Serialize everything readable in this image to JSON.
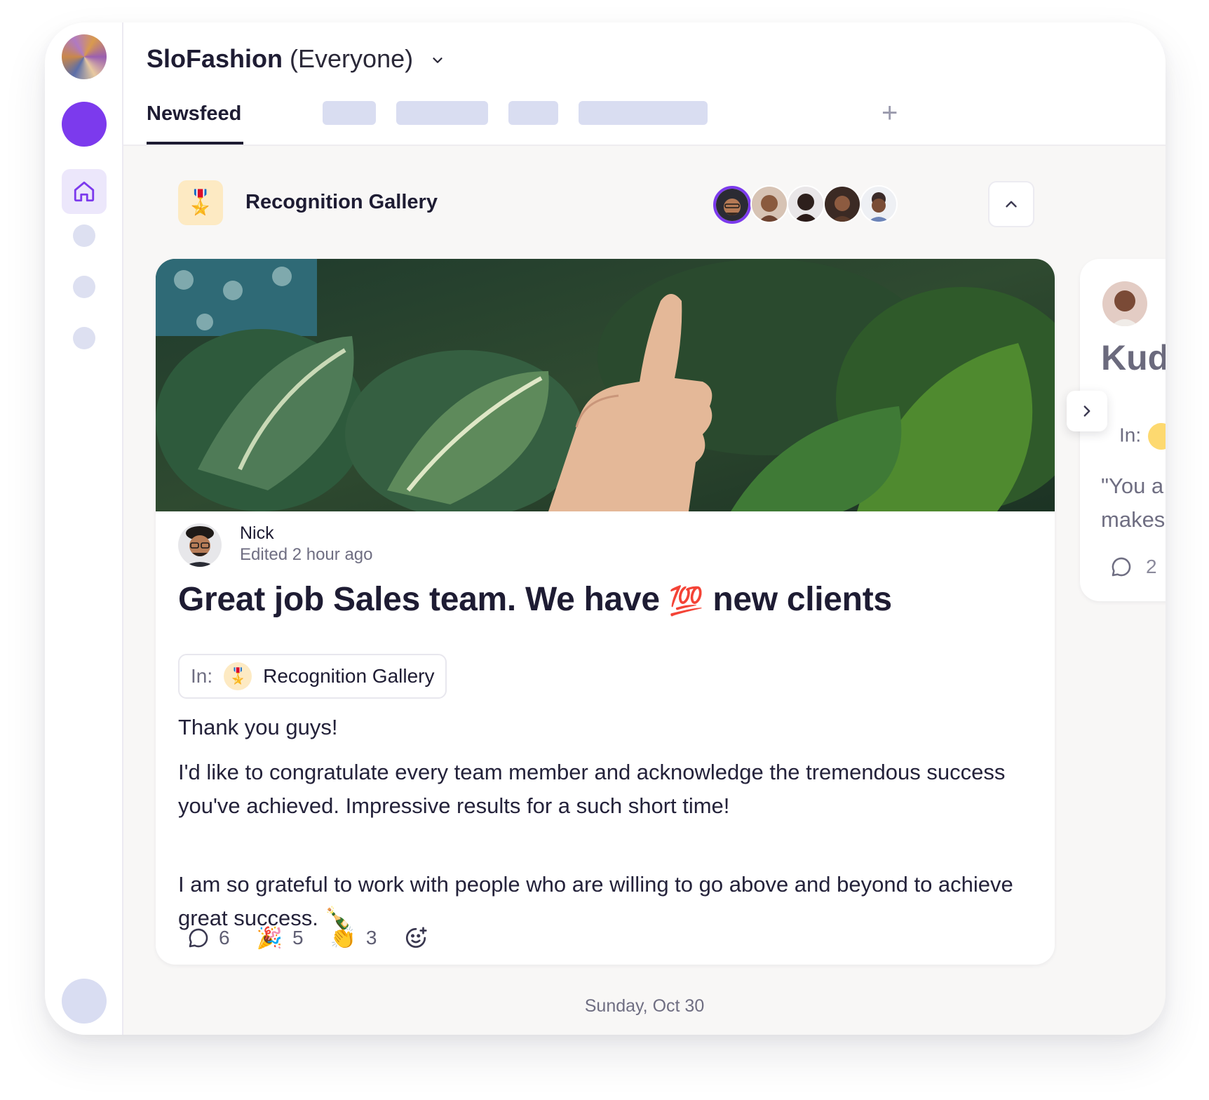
{
  "workspace": {
    "name": "SloFashion",
    "scope": "(Everyone)"
  },
  "tabs": {
    "active": "Newsfeed",
    "add": "+"
  },
  "gallery": {
    "icon": "🎖️",
    "title": "Recognition Gallery"
  },
  "post": {
    "author": "Nick",
    "meta": "Edited 2 hour ago",
    "title_start": "Great job Sales team. We have",
    "title_emoji": "💯",
    "title_end": "new clients",
    "in_label": "In:",
    "in_icon": "🎖️",
    "in_value": "Recognition Gallery",
    "body": {
      "line1": "Thank you guys!",
      "line2": "I'd like to congratulate every team member and acknowledge the tremendous success you've achieved. Impressive results for a such short time!",
      "line3": "I am so grateful to work with people who are willing to go above and beyond to achieve great success. 🍾"
    },
    "reactions": {
      "comments": "6",
      "party_emoji": "🎉",
      "party": "5",
      "clap_emoji": "👏",
      "clap": "3"
    }
  },
  "peek": {
    "title": "Kud",
    "in_label": "In:",
    "quote_line1": "\"You a",
    "quote_line2": "makes",
    "comments": "2"
  },
  "date_label": "Sunday, Oct 30",
  "colors": {
    "accent": "#7c3aed",
    "placeholder": "#d9ddf1",
    "gallery_bg": "#fdeac3"
  }
}
